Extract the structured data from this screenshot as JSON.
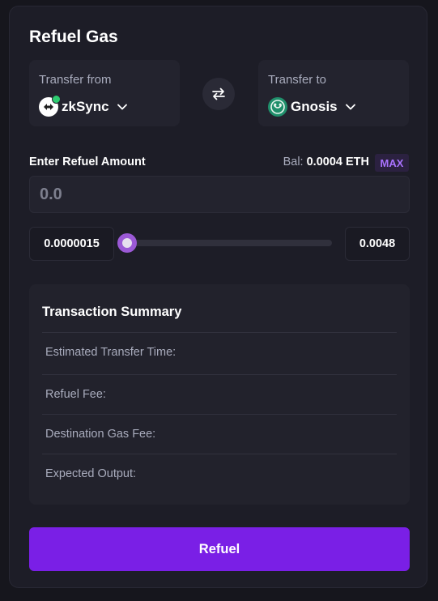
{
  "title": "Refuel Gas",
  "transfer_from": {
    "label": "Transfer from",
    "chain": "zkSync",
    "icon": "zksync-logo-icon"
  },
  "transfer_to": {
    "label": "Transfer to",
    "chain": "Gnosis",
    "icon": "gnosis-logo-icon"
  },
  "amount": {
    "label": "Enter Refuel Amount",
    "balance_prefix": "Bal:",
    "balance_value": "0.0004 ETH",
    "max_label": "MAX",
    "placeholder": "0.0",
    "range_min": "0.0000015",
    "range_max": "0.0048",
    "slider_level": 0
  },
  "summary": {
    "title": "Transaction Summary",
    "rows": [
      {
        "label": "Estimated Transfer Time:"
      },
      {
        "label": "Refuel Fee:"
      },
      {
        "label": "Destination Gas Fee:"
      },
      {
        "label": "Expected Output:"
      }
    ]
  },
  "action": {
    "refuel_label": "Refuel"
  },
  "colors": {
    "accent": "#7a1fe6",
    "slider": "#9b59d6",
    "max_text": "#a972ff",
    "online": "#2ecc71",
    "gnosis": "#1f8f6b"
  }
}
